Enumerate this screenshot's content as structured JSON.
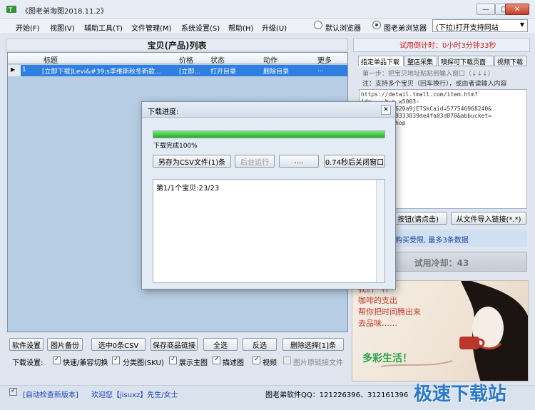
{
  "window": {
    "title": "《图老弟淘图2018.11.2》",
    "min": "—",
    "max": "□",
    "close": "✕"
  },
  "menu": [
    "开始(F)",
    "视图(V)",
    "辅助工具(T)",
    "文件管理(M)",
    "系统设置(S)",
    "帮助(H)",
    "升级(U)"
  ],
  "browser": {
    "radio_default": "默认浏览器",
    "radio_single": "图老弟浏览器",
    "dropdown": "(下拉)打开支持网站"
  },
  "list": {
    "title": "宝贝(产品)列表",
    "columns": [
      "标题",
      "价格",
      "状态",
      "动作",
      "更多"
    ],
    "rows": [
      {
        "index": "1",
        "title": "[立即下载]Levi&#39;s李维斯秋冬新款...",
        "price": "[立即...",
        "status": "打开目录",
        "action": "删除目录",
        "more": "..."
      }
    ]
  },
  "buttons": {
    "settings": "软件设置",
    "image_backup": "图片备份",
    "select_csv": "选中0条CSV",
    "save_link": "保存商品链接",
    "select_all": "全选",
    "invert": "反选",
    "delete_selected": "删除选择[1]条"
  },
  "download_settings": {
    "label": "下载设置:",
    "options": [
      {
        "label": "快速/兼容切换",
        "checked": true
      },
      {
        "label": "分类图(SKU)",
        "checked": true
      },
      {
        "label": "展示主图",
        "checked": true
      },
      {
        "label": "描述图",
        "checked": true
      },
      {
        "label": "视频",
        "checked": true
      },
      {
        "label": "图片原链接文件",
        "checked": false
      }
    ]
  },
  "right": {
    "trial": "试用倒计时：0小时3分钟33秒",
    "tabs": [
      "指定单品下载",
      "整店采集",
      "嗅探可下载页面",
      "视频下载"
    ],
    "hint1": "第一步：把宝贝地址粘贴到输入窗口（↓↓↓）",
    "hint2": "注：支持多个宝贝（回车换行），或由者读输入内容",
    "url_lines": [
      "https://detail.tmall.com/item.htm?",
      "id=...-b-s.w5003-",
      "...1.5.331620a9jETSkCaid=577546968240&",
      "...9ffa0489333839de4fa03d870&abbucket=",
      "...aobao_shop"
    ],
    "btn_click": "按钮(请点击)",
    "btn_import": "从文件导入链接(*.*)",
    "notice": "购买受限, 最多3条数据",
    "cooldown": "试用冷却：43",
    "ad": [
      "我们一杯",
      "咖啡的支出",
      "帮你把时间腾出来",
      "去品味……",
      "多彩生活！"
    ]
  },
  "status": {
    "auto_check": "[自动检查新版本]",
    "welcome": "欢迎您【jisuxz】先生/女士",
    "qq": "图老弟软件QQ：121226396、312161396",
    "logo": "极速下载站"
  },
  "dialog": {
    "title": "下载进度:",
    "progress_percent": 100,
    "progress_text": "下载完成100%",
    "btn_save_csv": "另存为CSV文件(1)条",
    "btn_background": "后台运行",
    "btn_dots": "....",
    "btn_close": "0.74秒后关闭窗口",
    "log": "第1/1个宝贝:23/23"
  }
}
